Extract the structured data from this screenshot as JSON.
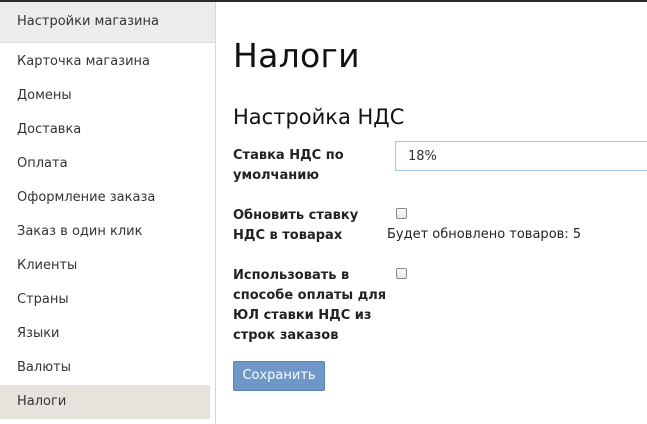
{
  "sidebar": {
    "header": "Настройки магазина",
    "items": [
      {
        "label": "Карточка магазина"
      },
      {
        "label": "Домены"
      },
      {
        "label": "Доставка"
      },
      {
        "label": "Оплата"
      },
      {
        "label": "Оформление заказа"
      },
      {
        "label": "Заказ в один клик"
      },
      {
        "label": "Клиенты"
      },
      {
        "label": "Страны"
      },
      {
        "label": "Языки"
      },
      {
        "label": "Валюты"
      },
      {
        "label": "Налоги"
      }
    ],
    "active_item": "Налоги"
  },
  "main": {
    "title": "Налоги",
    "section_title": "Настройка НДС",
    "fields": {
      "default_rate": {
        "label_line1": "Ставка НДС по",
        "label_line2": "умолчанию",
        "value": "18%"
      },
      "update_products": {
        "label_line1": "Обновить ставку",
        "label_line2": "НДС в товарах",
        "checked": false,
        "hint": "Будет обновлено товаров: 5"
      },
      "use_in_payment": {
        "label_line1": "Использовать в",
        "label_line2": "способе оплаты для",
        "label_line3": "ЮЛ ставки НДС из",
        "label_line4": "строк заказов",
        "checked": false
      }
    },
    "save_label": "Сохранить"
  },
  "colors": {
    "accent": "#6f98c8",
    "active_item_bg": "#e6e3dc",
    "sidebar_header_bg": "#ececec",
    "input_border": "#9ec3e6"
  }
}
